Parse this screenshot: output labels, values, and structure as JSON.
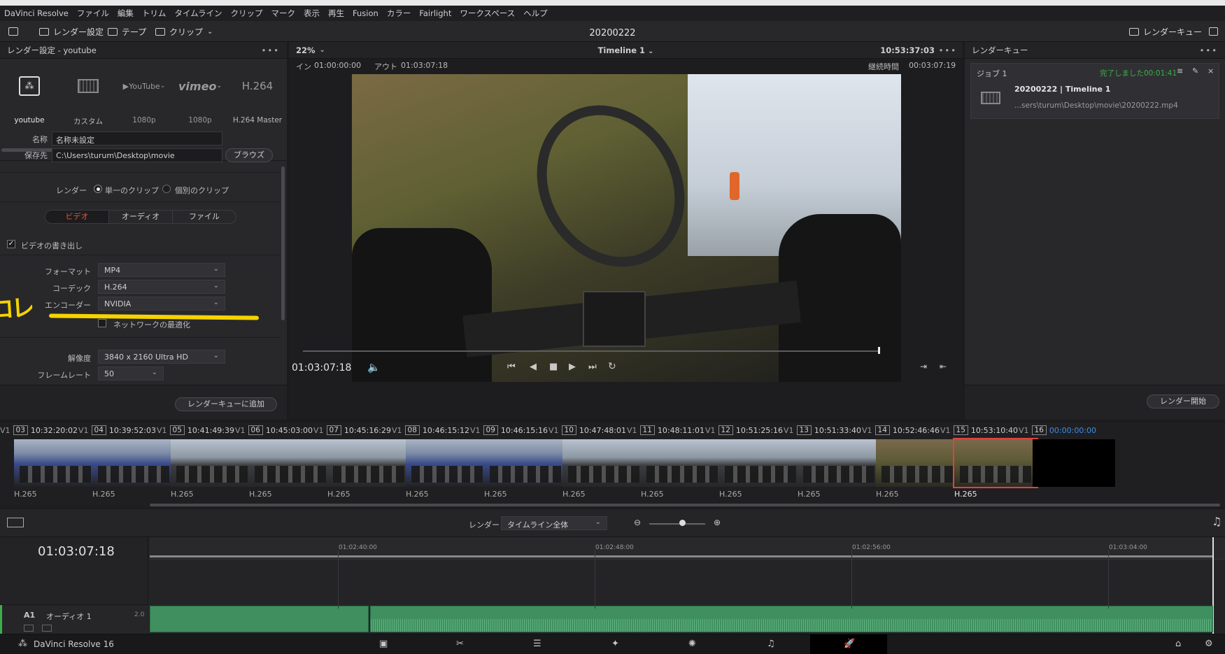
{
  "window": {
    "title": "20200222"
  },
  "menu": [
    "DaVinci Resolve",
    "ファイル",
    "編集",
    "トリム",
    "タイムライン",
    "クリップ",
    "マーク",
    "表示",
    "再生",
    "Fusion",
    "カラー",
    "Fairlight",
    "ワークスペース",
    "ヘルプ"
  ],
  "toolbar": {
    "render_settings": "レンダー設定",
    "tape": "テープ",
    "clip": "クリップ",
    "project_title": "20200222",
    "render_queue": "レンダーキュー"
  },
  "render_panel": {
    "header": "レンダー設定 - youtube",
    "presets": [
      {
        "name": "youtube",
        "sub": ""
      },
      {
        "name": "カスタム",
        "sub": ""
      },
      {
        "name": "YouTube",
        "sub": "1080p"
      },
      {
        "name": "vimeo",
        "sub": "1080p"
      },
      {
        "name": "H.264",
        "sub": "H.264 Master"
      }
    ],
    "name_label": "名称",
    "name_value": "名称未設定",
    "location_label": "保存先",
    "location_value": "C:\\Users\\turum\\Desktop\\movie",
    "browse": "ブラウズ",
    "render_label": "レンダー",
    "single_clip": "単一のクリップ",
    "individual_clips": "個別のクリップ",
    "tabs": [
      "ビデオ",
      "オーディオ",
      "ファイル"
    ],
    "export_video": "ビデオの書き出し",
    "format_label": "フォーマット",
    "format_value": "MP4",
    "codec_label": "コーデック",
    "codec_value": "H.264",
    "encoder_label": "エンコーダー",
    "encoder_value": "NVIDIA",
    "network_opt": "ネットワークの最適化",
    "resolution_label": "解像度",
    "resolution_value": "3840 x 2160 Ultra HD",
    "framerate_label": "フレームレート",
    "framerate_value": "50",
    "add_to_queue": "レンダーキューに追加",
    "annotation": "コレ"
  },
  "viewer": {
    "zoom": "22%",
    "timeline_name": "Timeline 1",
    "timecode_top": "10:53:37:03",
    "in_label": "イン",
    "in_value": "01:00:00:00",
    "out_label": "アウト",
    "out_value": "01:03:07:18",
    "duration_label": "継続時間",
    "duration_value": "00:03:07:19",
    "current_tc": "01:03:07:18"
  },
  "queue": {
    "header": "レンダーキュー",
    "job_label": "ジョブ 1",
    "job_status": "完了しました00:01:41",
    "job_title": "20200222 | Timeline 1",
    "job_path": "...sers\\turum\\Desktop\\movie\\20200222.mp4",
    "start_render": "レンダー開始"
  },
  "clips": [
    {
      "num": "03",
      "tc": "10:32:20:02",
      "codec": "H.265",
      "kind": "blue"
    },
    {
      "num": "04",
      "tc": "10:39:52:03",
      "codec": "H.265",
      "kind": "blue"
    },
    {
      "num": "05",
      "tc": "10:41:49:39",
      "codec": "H.265",
      "kind": "road"
    },
    {
      "num": "06",
      "tc": "10:45:03:00",
      "codec": "H.265",
      "kind": "road"
    },
    {
      "num": "07",
      "tc": "10:45:16:29",
      "codec": "H.265",
      "kind": "road"
    },
    {
      "num": "08",
      "tc": "10:46:15:12",
      "codec": "H.265",
      "kind": "blue"
    },
    {
      "num": "09",
      "tc": "10:46:15:16",
      "codec": "H.265",
      "kind": "blue"
    },
    {
      "num": "10",
      "tc": "10:47:48:01",
      "codec": "H.265",
      "kind": "road"
    },
    {
      "num": "11",
      "tc": "10:48:11:01",
      "codec": "H.265",
      "kind": "road"
    },
    {
      "num": "12",
      "tc": "10:51:25:16",
      "codec": "H.265",
      "kind": "road"
    },
    {
      "num": "13",
      "tc": "10:51:33:40",
      "codec": "H.265",
      "kind": "road"
    },
    {
      "num": "14",
      "tc": "10:52:46:46",
      "codec": "H.265",
      "kind": "grass"
    },
    {
      "num": "15",
      "tc": "10:53:10:40",
      "codec": "H.265",
      "kind": "grass"
    },
    {
      "num": "16",
      "tc": "00:00:00:00",
      "codec": "",
      "kind": "black"
    }
  ],
  "clip_track_label": "V1",
  "timeline": {
    "render_label": "レンダー",
    "render_scope": "タイムライン全体",
    "current_tc": "01:03:07:18",
    "ruler": [
      "01:02:40:00",
      "01:02:48:00",
      "01:02:56:00",
      "01:03:04:00"
    ],
    "audio_track": "A1",
    "audio_name": "オーディオ 1",
    "audio_level": "2.0"
  },
  "bottom": {
    "app_name": "DaVinci Resolve 16"
  }
}
